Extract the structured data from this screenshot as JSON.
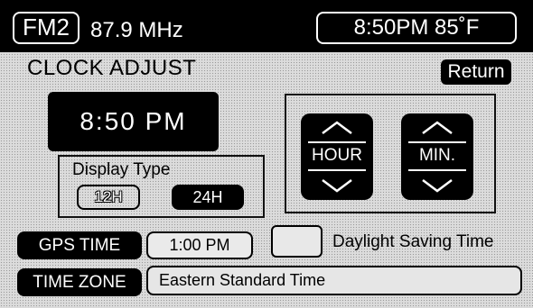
{
  "header": {
    "band": "FM2",
    "frequency": "87.9 MHz",
    "time_temp": "8:50PM 85˚F"
  },
  "page": {
    "title": "CLOCK ADJUST",
    "return_label": "Return"
  },
  "clock": {
    "display": "8:50 PM"
  },
  "display_type": {
    "label": "Display Type",
    "option_12h": "12H",
    "option_24h": "24H",
    "selected": "24H"
  },
  "adjust": {
    "hour_label": "HOUR",
    "min_label": "MIN.",
    "up_icon": "chevron-up-icon",
    "down_icon": "chevron-down-icon"
  },
  "gps": {
    "button_label": "GPS TIME",
    "time_value": "1:00 PM"
  },
  "dst": {
    "label": "Daylight Saving Time",
    "checked": false
  },
  "timezone": {
    "button_label": "TIME ZONE",
    "value": "Eastern Standard Time"
  },
  "colors": {
    "background": "#dcdcdc",
    "foreground": "#000000",
    "active": "#000000",
    "inverse_text": "#ffffff"
  }
}
